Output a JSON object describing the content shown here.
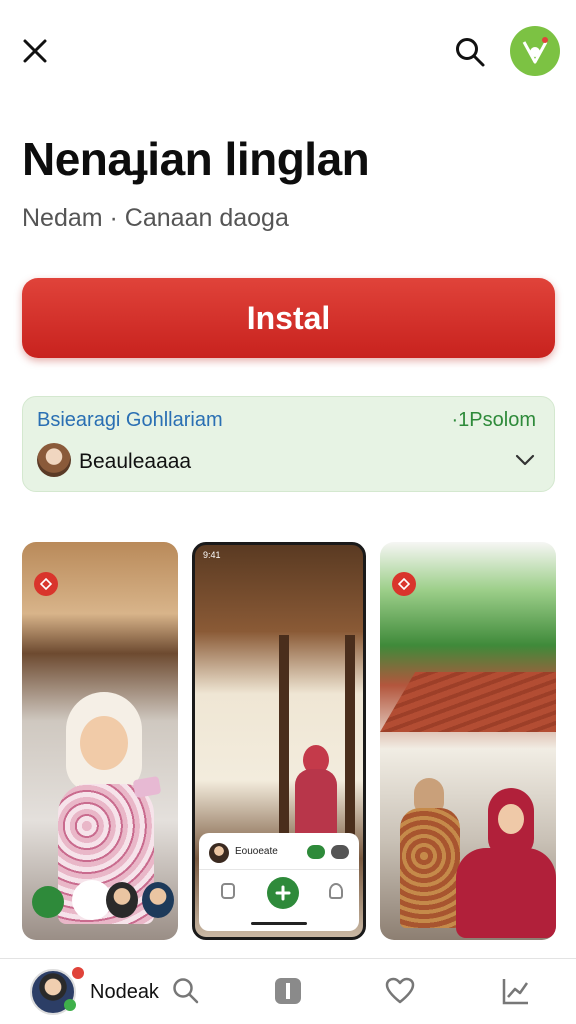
{
  "header": {
    "close_icon": "close-icon",
    "search_icon": "search-icon",
    "logo_icon": "app-logo-icon",
    "accent": "#7cc243"
  },
  "app": {
    "title": "Nenaɟian linglan",
    "subtitle": "Nedam · Canaan daoga"
  },
  "install": {
    "label": "Instal",
    "color": "#d32f2a"
  },
  "info_card": {
    "title": "Bsiearagi Gohllariam",
    "badge": "·1Psolom",
    "developer": "Beauleaaaa",
    "background": "#e7f3e4"
  },
  "screenshots": {
    "shot2_time": "9:41",
    "shot2_contact": "Eouoeate"
  },
  "bottom_nav": {
    "profile_label": "Nodeak",
    "items": [
      "search-icon",
      "app-icon",
      "heart-icon",
      "chart-icon"
    ]
  }
}
